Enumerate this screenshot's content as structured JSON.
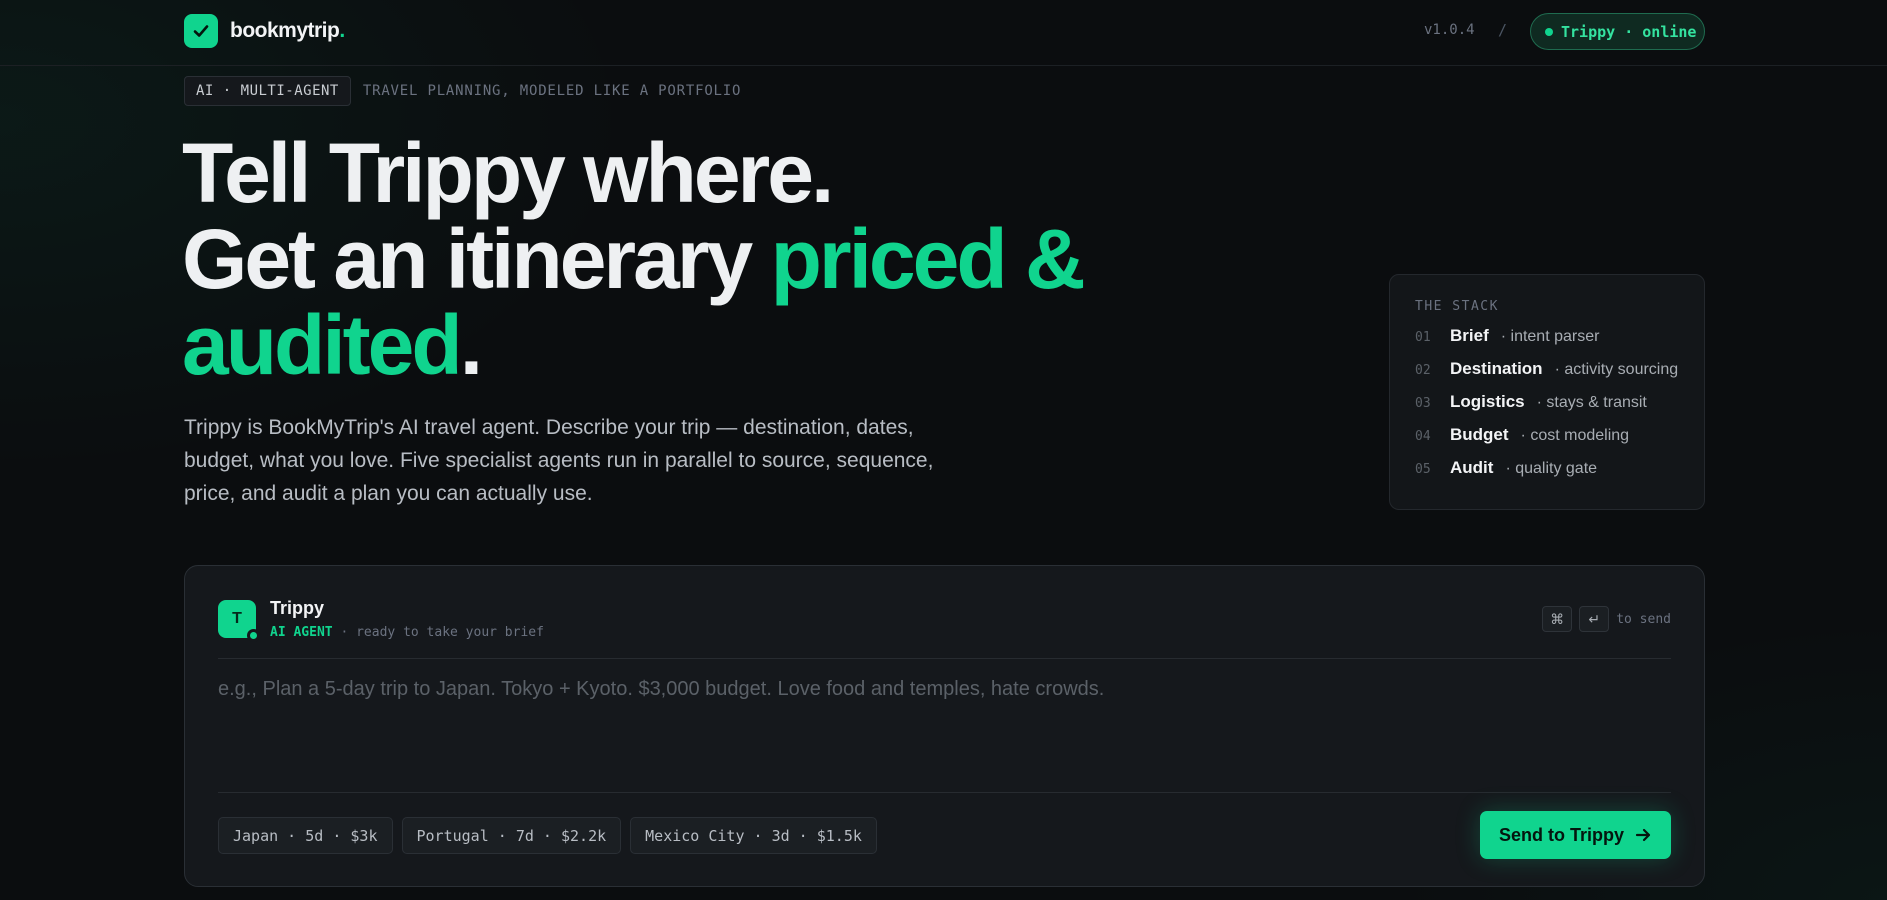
{
  "header": {
    "logo_name": "bookmytrip",
    "logo_dot": ".",
    "version": "v1.0.4",
    "separator": "/",
    "status": "Trippy · online"
  },
  "eyebrow": {
    "tag": "AI · MULTI-AGENT",
    "text": "TRAVEL PLANNING, MODELED LIKE A PORTFOLIO"
  },
  "hero": {
    "line1": "Tell Trippy where.",
    "line2_start": "Get an itinerary ",
    "line2_accent": "priced &",
    "line3_accent": "audited",
    "line3_end": ".",
    "description": "Trippy is BookMyTrip's AI travel agent. Describe your trip — destination, dates, budget, what you love. Five specialist agents run in parallel to source, sequence, price, and audit a plan you can actually use."
  },
  "stack": {
    "title": "THE STACK",
    "items": [
      {
        "num": "01",
        "name": "Brief",
        "desc": "· intent parser"
      },
      {
        "num": "02",
        "name": "Destination",
        "desc": "· activity sourcing"
      },
      {
        "num": "03",
        "name": "Logistics",
        "desc": "· stays & transit"
      },
      {
        "num": "04",
        "name": "Budget",
        "desc": "· cost modeling"
      },
      {
        "num": "05",
        "name": "Audit",
        "desc": "· quality gate"
      }
    ]
  },
  "composer": {
    "avatar_letter": "T",
    "agent_name": "Trippy",
    "agent_role": "AI AGENT",
    "agent_status": " · ready to take your brief",
    "key_cmd": "⌘",
    "key_enter": "↵",
    "send_hint": "to send",
    "input_value": "",
    "input_placeholder": "e.g., Plan a 5-day trip to Japan. Tokyo + Kyoto. $3,000 budget. Love food and temples, hate crowds.",
    "chips": [
      "Japan · 5d · $3k",
      "Portugal · 7d · $2.2k",
      "Mexico City · 3d · $1.5k"
    ],
    "send_label": "Send to Trippy"
  },
  "colors": {
    "accent": "#10d48e",
    "background": "#0b0d0f",
    "panel": "#15181c"
  },
  "icons": [
    "check-icon",
    "status-dot-icon",
    "command-key-icon",
    "enter-key-icon",
    "arrow-right-icon"
  ]
}
